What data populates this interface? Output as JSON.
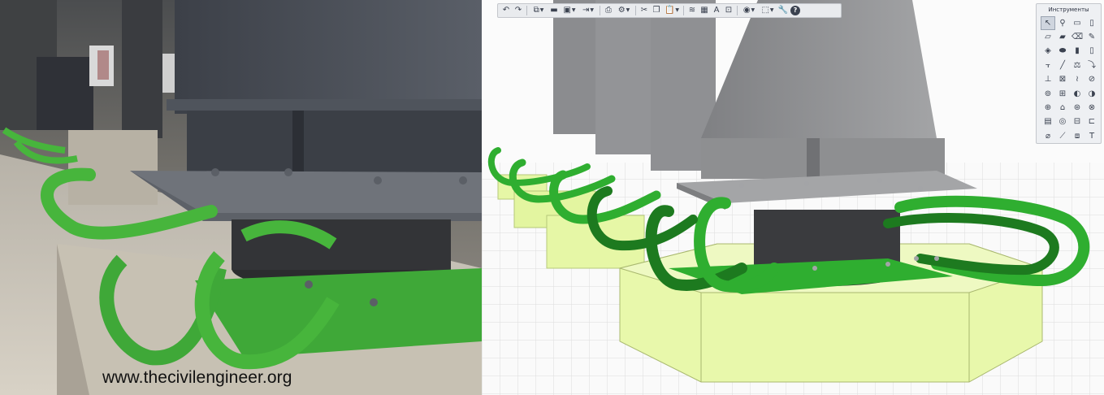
{
  "photo": {
    "watermark": "www.thecivilengineer.org"
  },
  "toolbar": {
    "buttons": [
      {
        "id": "undo",
        "icon": "undo-icon",
        "glyph": "↶"
      },
      {
        "id": "redo",
        "icon": "redo-icon",
        "glyph": "↷"
      },
      {
        "id": "new",
        "icon": "new-model-icon",
        "glyph": "⧉",
        "caret": true
      },
      {
        "id": "open",
        "icon": "folder-open-icon",
        "glyph": "▬"
      },
      {
        "id": "save",
        "icon": "save-icon",
        "glyph": "▣",
        "caret": true
      },
      {
        "id": "export",
        "icon": "export-icon",
        "glyph": "⇥",
        "caret": true
      },
      {
        "id": "print",
        "icon": "print-icon",
        "glyph": "⎙"
      },
      {
        "id": "settings",
        "icon": "gear-icon",
        "glyph": "⚙",
        "caret": true
      },
      {
        "id": "cut",
        "icon": "cut-icon",
        "glyph": "✂"
      },
      {
        "id": "copy",
        "icon": "copy-icon",
        "glyph": "❐"
      },
      {
        "id": "paste",
        "icon": "paste-icon",
        "glyph": "📋",
        "caret": true
      },
      {
        "id": "layers",
        "icon": "layers-icon",
        "glyph": "≋"
      },
      {
        "id": "calc",
        "icon": "calculate-icon",
        "glyph": "▦"
      },
      {
        "id": "text-style",
        "icon": "text-style-icon",
        "glyph": "A"
      },
      {
        "id": "snap",
        "icon": "snap-icon",
        "glyph": "⊡"
      },
      {
        "id": "visibility",
        "icon": "eye-icon",
        "glyph": "◉",
        "caret": true
      },
      {
        "id": "views",
        "icon": "view-cube-icon",
        "glyph": "⬚",
        "caret": true
      },
      {
        "id": "tools",
        "icon": "wrench-icon",
        "glyph": "🔧"
      },
      {
        "id": "help",
        "icon": "help-icon",
        "glyph": "?"
      }
    ]
  },
  "tools_panel": {
    "title": "Инструменты",
    "tools": [
      {
        "icon": "cursor-icon",
        "glyph": "↖",
        "active": true
      },
      {
        "icon": "node-tool-icon",
        "glyph": "⚲"
      },
      {
        "icon": "rectangle-tool-icon",
        "glyph": "▭"
      },
      {
        "icon": "column-tool-icon",
        "glyph": "▯"
      },
      {
        "icon": "beam-tool-icon",
        "glyph": "▱"
      },
      {
        "icon": "slab-tool-icon",
        "glyph": "▰"
      },
      {
        "icon": "eraser-tool-icon",
        "glyph": "⌫"
      },
      {
        "icon": "pencil-tool-icon",
        "glyph": "✎"
      },
      {
        "icon": "surface-tool-icon",
        "glyph": "◈"
      },
      {
        "icon": "plate-tool-icon",
        "glyph": "⬬"
      },
      {
        "icon": "wall-tool-icon",
        "glyph": "▮"
      },
      {
        "icon": "opening-tool-icon",
        "glyph": "▯"
      },
      {
        "icon": "frame-tool-icon",
        "glyph": "⫟"
      },
      {
        "icon": "line-tool-icon",
        "glyph": "╱"
      },
      {
        "icon": "load-tool-icon",
        "glyph": "⚖"
      },
      {
        "icon": "distributed-load-icon",
        "glyph": "⤵"
      },
      {
        "icon": "support-tool-icon",
        "glyph": "⊥"
      },
      {
        "icon": "hinge-tool-icon",
        "glyph": "⊠"
      },
      {
        "icon": "spring-tool-icon",
        "glyph": "≀"
      },
      {
        "icon": "rigid-link-icon",
        "glyph": "⊘"
      },
      {
        "icon": "section-tool-icon",
        "glyph": "⊚"
      },
      {
        "icon": "mesh-tool-icon",
        "glyph": "⊞"
      },
      {
        "icon": "material-tool-icon",
        "glyph": "◐"
      },
      {
        "icon": "thickness-tool-icon",
        "glyph": "◑"
      },
      {
        "icon": "group-tool-icon",
        "glyph": "⊕"
      },
      {
        "icon": "house-tool-icon",
        "glyph": "⌂"
      },
      {
        "icon": "pile-tool-icon",
        "glyph": "⊛"
      },
      {
        "icon": "soil-tool-icon",
        "glyph": "⊗"
      },
      {
        "icon": "report-tool-icon",
        "glyph": "▤"
      },
      {
        "icon": "target-tool-icon",
        "glyph": "◎"
      },
      {
        "icon": "measure-tool-icon",
        "glyph": "⊟"
      },
      {
        "icon": "bracket-tool-icon",
        "glyph": "⊏"
      },
      {
        "icon": "dimension-tool-icon",
        "glyph": "⌀"
      },
      {
        "icon": "cut-line-tool-icon",
        "glyph": "⟋"
      },
      {
        "icon": "annotation-tool-icon",
        "glyph": "⧈"
      },
      {
        "icon": "text-tool-icon",
        "glyph": "T"
      }
    ]
  },
  "colors": {
    "isolator_green": "#2fae30",
    "isolator_green_dark": "#1d7a1f",
    "photo_green": "#47b53c",
    "foundation_yellow": "#e6f7a6",
    "steel_gray": "#8e8f91",
    "rubber_dark": "#3a3b3e"
  }
}
